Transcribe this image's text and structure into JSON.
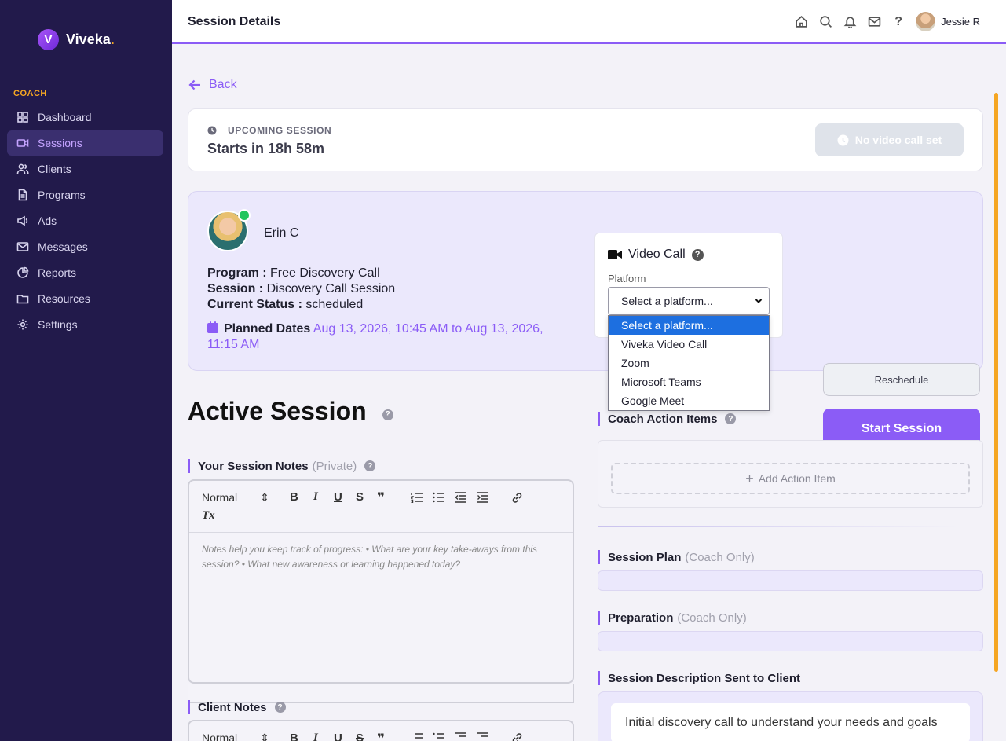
{
  "brand": {
    "name": "Viveka",
    "dot": ".",
    "logo_letter": "V"
  },
  "sidebar": {
    "section": "COACH",
    "items": [
      {
        "label": "Dashboard",
        "icon": "grid-icon"
      },
      {
        "label": "Sessions",
        "icon": "video-icon",
        "active": true
      },
      {
        "label": "Clients",
        "icon": "users-icon"
      },
      {
        "label": "Programs",
        "icon": "document-icon"
      },
      {
        "label": "Ads",
        "icon": "megaphone-icon"
      },
      {
        "label": "Messages",
        "icon": "mail-icon"
      },
      {
        "label": "Reports",
        "icon": "pie-chart-icon"
      },
      {
        "label": "Resources",
        "icon": "folder-icon"
      },
      {
        "label": "Settings",
        "icon": "gear-icon"
      }
    ]
  },
  "header": {
    "title": "Session Details",
    "help": "?",
    "user_name": "Jessie R"
  },
  "back_label": "Back",
  "upcoming": {
    "label": "UPCOMING SESSION",
    "starts_in": "Starts in 18h 58m",
    "video_button": "No video call set"
  },
  "client": {
    "name": "Erin C",
    "program_label": "Program :",
    "program": "Free Discovery Call",
    "session_label": "Session :",
    "session": "Discovery Call Session",
    "status_label": "Current Status :",
    "status": "scheduled",
    "planned_label": "Planned Dates",
    "planned_range": "Aug 13, 2026, 10:45 AM to Aug 13, 2026, 11:15 AM"
  },
  "video_call": {
    "title": "Video Call",
    "help": "?",
    "platform_label": "Platform",
    "selected": "Select a platform...",
    "options": [
      "Select a platform...",
      "Viveka Video Call",
      "Zoom",
      "Microsoft Teams",
      "Google Meet"
    ]
  },
  "buttons": {
    "reschedule": "Reschedule",
    "start": "Start Session"
  },
  "active_session": {
    "title": "Active Session",
    "help": "?"
  },
  "notes": {
    "title": "Your Session Notes",
    "suffix": "(Private)",
    "help": "?",
    "placeholder": "Notes help you keep track of progress: • What are your key take-aways from this session? • What new awareness or learning happened today?"
  },
  "editor_toolbar": {
    "style": "Normal",
    "style_arrow": "⇕",
    "bold": "B",
    "italic": "I",
    "underline": "U",
    "strike": "S",
    "quote": "❞",
    "clear": "Tx"
  },
  "client_notes": {
    "title": "Client Notes",
    "help": "?"
  },
  "action_items": {
    "title": "Coach Action Items",
    "help": "?",
    "add_label": "Add Action Item",
    "add_plus": "+"
  },
  "session_plan": {
    "title": "Session Plan",
    "suffix": "(Coach Only)"
  },
  "preparation": {
    "title": "Preparation",
    "suffix": "(Coach Only)"
  },
  "description": {
    "title": "Session Description Sent to Client",
    "text": "Initial discovery call to understand your needs and goals"
  },
  "colors": {
    "sidebar": "#221a4b",
    "accent": "#8b5cf6",
    "gold": "#f5a623",
    "online": "#22c55e"
  }
}
